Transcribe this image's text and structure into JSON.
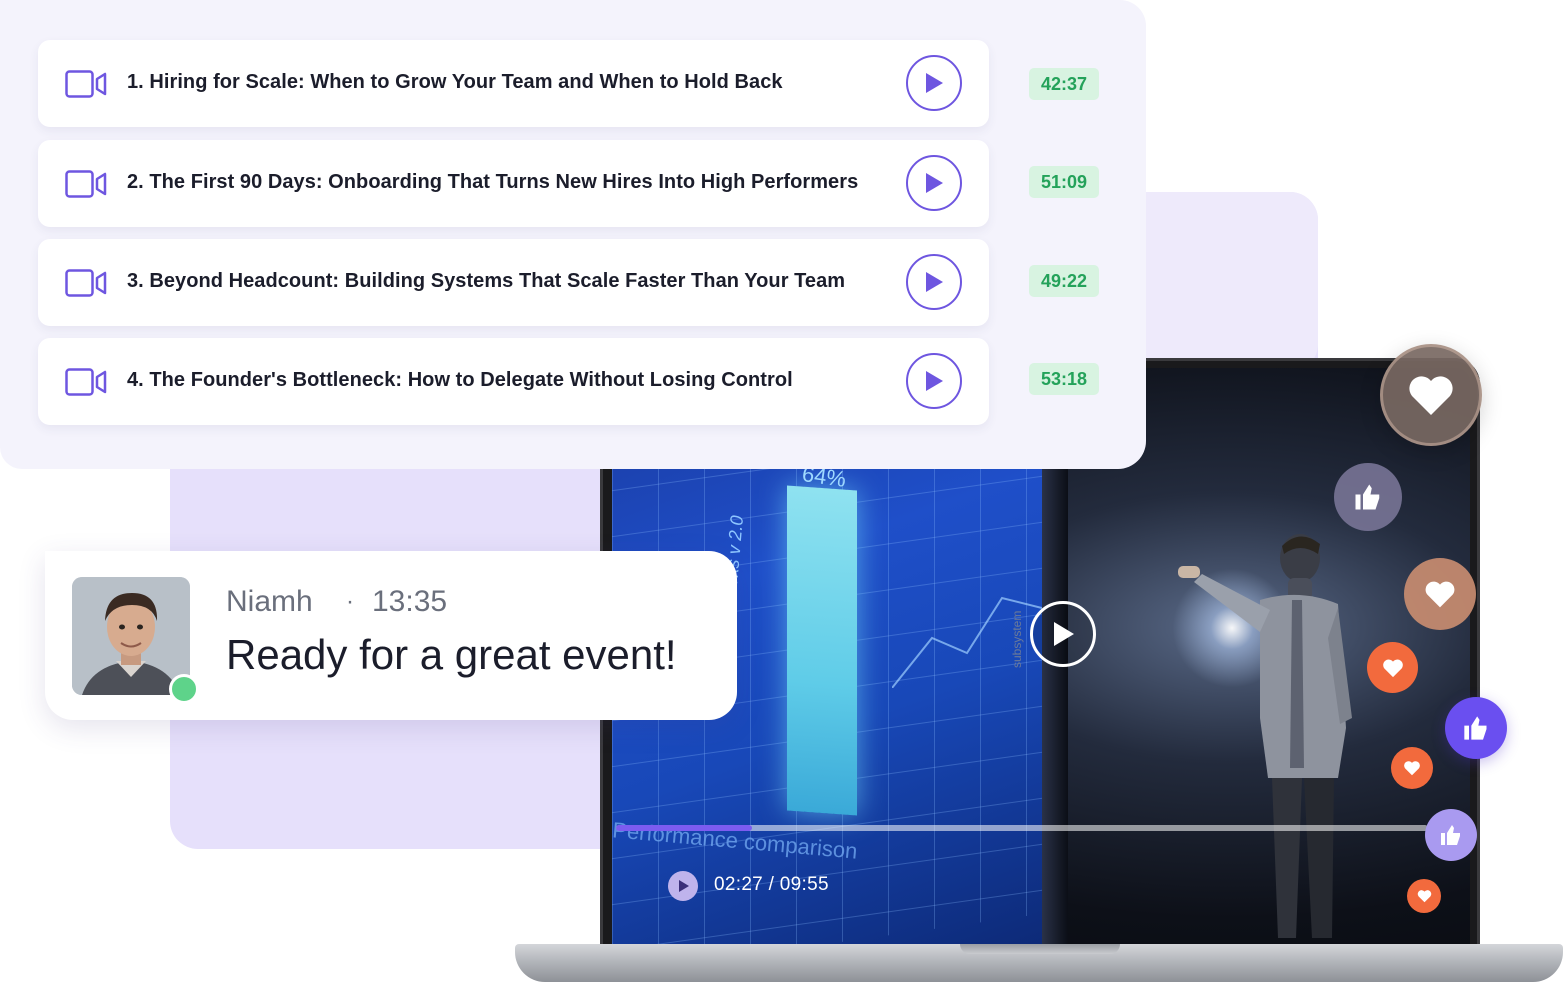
{
  "playlist": {
    "lessons": [
      {
        "title": "1. Hiring for Scale: When to Grow Your Team and When to Hold Back",
        "duration": "42:37"
      },
      {
        "title": "2. The First 90 Days: Onboarding That Turns New Hires Into High Performers",
        "duration": "51:09"
      },
      {
        "title": "3. Beyond Headcount: Building Systems That Scale Faster Than Your Team",
        "duration": "49:22"
      },
      {
        "title": "4. The Founder's Bottleneck: How to Delegate Without Losing Control",
        "duration": "53:18"
      }
    ]
  },
  "chat": {
    "name": "Niamh",
    "separator": "·",
    "time": "13:35",
    "message": "Ready for a great event!"
  },
  "video": {
    "time_display": "02:27 / 09:55",
    "progress_fraction": 0.168,
    "screen_text": {
      "bar_value": "64%",
      "vertical_label": "Neural networks v 2.0",
      "bottom_label": "Performance comparison",
      "side_label": "subsystem"
    }
  },
  "colors": {
    "accent_purple": "#6e56e0",
    "duration_bg": "#d8f3e1",
    "duration_text": "#24a25a",
    "online": "#5ed38a",
    "reaction_orange": "#f26a3d",
    "reaction_purple": "#6a4ff0"
  },
  "icons": {
    "lesson": "video-camera-icon",
    "play": "play-icon",
    "reactions": [
      "heart-icon",
      "thumbs-up-icon"
    ]
  }
}
